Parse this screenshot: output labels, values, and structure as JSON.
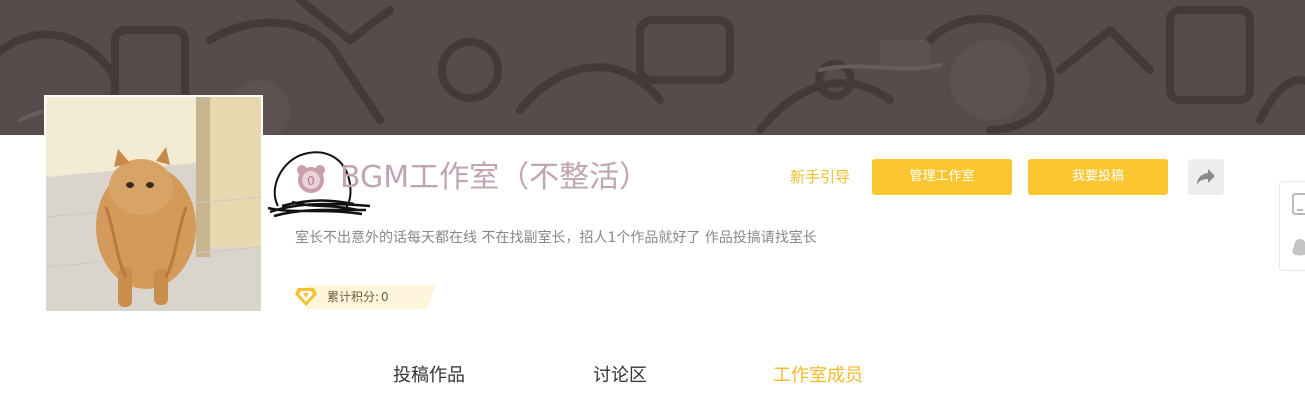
{
  "studio": {
    "name": "BGM工作室（不整活）",
    "description": "室长不出意外的话每天都在线 不在找副室长，招人1个作品就好了 作品投搞请找室长",
    "points_label": "累计积分:",
    "points_value": "0"
  },
  "actions": {
    "guide": "新手引导",
    "manage": "管理工作室",
    "submit": "我要投稿"
  },
  "tabs": [
    {
      "label": "投稿作品",
      "active": false
    },
    {
      "label": "讨论区",
      "active": false
    },
    {
      "label": "工作室成员",
      "active": true
    }
  ],
  "colors": {
    "banner": "#574b4b",
    "accent": "#fcc630",
    "active_tab": "#f5b92e",
    "title": "#c2a4b4"
  },
  "icons": {
    "studio": "bear-badge-icon",
    "share": "share-arrow-icon",
    "points": "diamond-gem-icon",
    "side_top": "phone-icon",
    "side_bottom": "qq-penguin-icon"
  }
}
